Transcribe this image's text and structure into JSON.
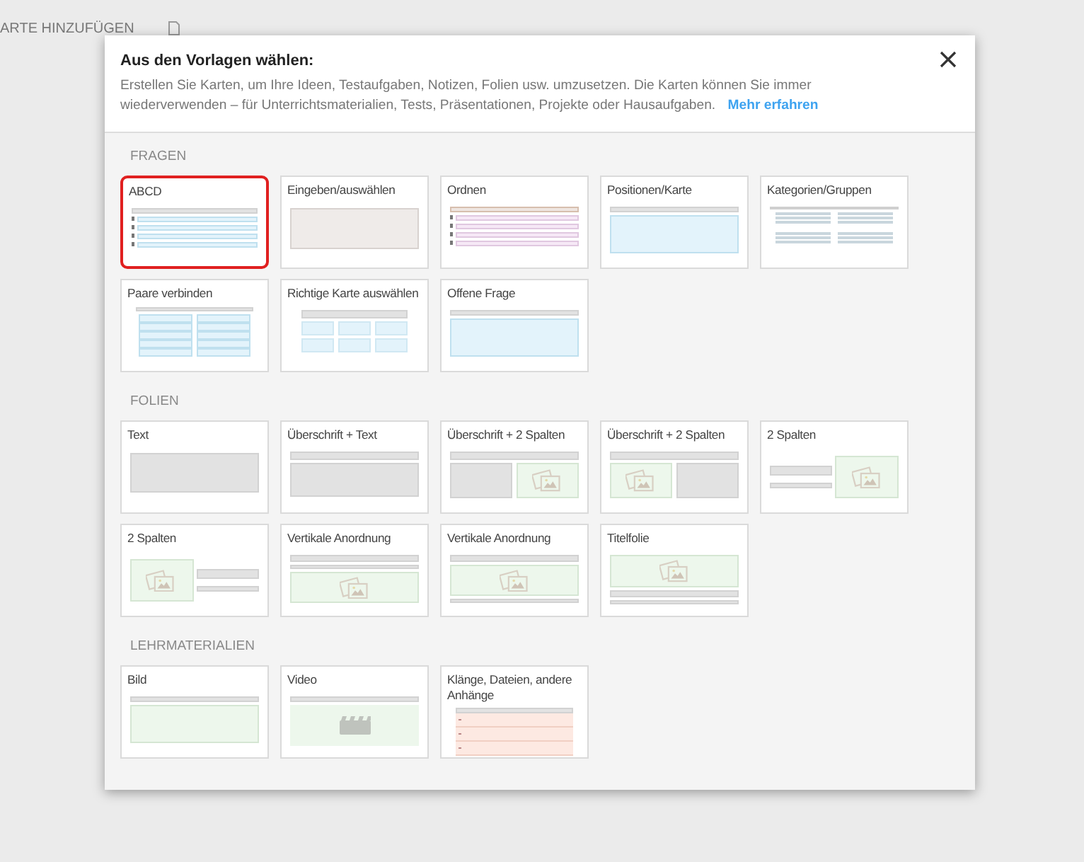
{
  "background_page": {
    "toolbar_label": "ARTE HINZUFÜGEN"
  },
  "dialog": {
    "title": "Aus den Vorlagen wählen:",
    "description": "Erstellen Sie Karten, um Ihre Ideen, Testaufgaben, Notizen, Folien usw. umzusetzen. Die Karten können Sie immer wiederverwenden – für Unterrichtsmaterialien, Tests, Präsentationen, Projekte oder Hausaufgaben.",
    "link": "Mehr erfahren"
  },
  "sections": [
    {
      "heading": "FRAGEN",
      "cards": [
        {
          "label": "ABCD",
          "kind": "abcd",
          "selected": true
        },
        {
          "label": "Eingeben/auswählen",
          "kind": "input",
          "selected": false
        },
        {
          "label": "Ordnen",
          "kind": "order",
          "selected": false
        },
        {
          "label": "Positionen/Karte",
          "kind": "positions",
          "selected": false
        },
        {
          "label": "Kategorien/Gruppen",
          "kind": "categories",
          "selected": false
        },
        {
          "label": "Paare verbinden",
          "kind": "pairs",
          "selected": false
        },
        {
          "label": "Richtige Karte auswählen",
          "kind": "pick",
          "selected": false
        },
        {
          "label": "Offene Frage",
          "kind": "open",
          "selected": false
        }
      ]
    },
    {
      "heading": "FOLIEN",
      "cards": [
        {
          "label": "Text",
          "kind": "text",
          "selected": false
        },
        {
          "label": "Überschrift + Text",
          "kind": "heading_text",
          "selected": false
        },
        {
          "label": "Überschrift + 2 Spalten",
          "kind": "heading_text_image",
          "selected": false
        },
        {
          "label": "Überschrift + 2 Spalten",
          "kind": "heading_image_text",
          "selected": false
        },
        {
          "label": "2 Spalten",
          "kind": "text_image",
          "selected": false
        },
        {
          "label": "2 Spalten",
          "kind": "image_text",
          "selected": false
        },
        {
          "label": "Vertikale Anordnung",
          "kind": "vertical_top",
          "selected": false
        },
        {
          "label": "Vertikale Anordnung",
          "kind": "vertical_bottom",
          "selected": false
        },
        {
          "label": "Titelfolie",
          "kind": "title",
          "selected": false
        }
      ]
    },
    {
      "heading": "LEHRMATERIALIEN",
      "cards": [
        {
          "label": "Bild",
          "kind": "image",
          "selected": false
        },
        {
          "label": "Video",
          "kind": "video",
          "selected": false
        },
        {
          "label": "Klänge, Dateien, andere Anhänge",
          "kind": "attachments",
          "selected": false
        }
      ]
    }
  ]
}
